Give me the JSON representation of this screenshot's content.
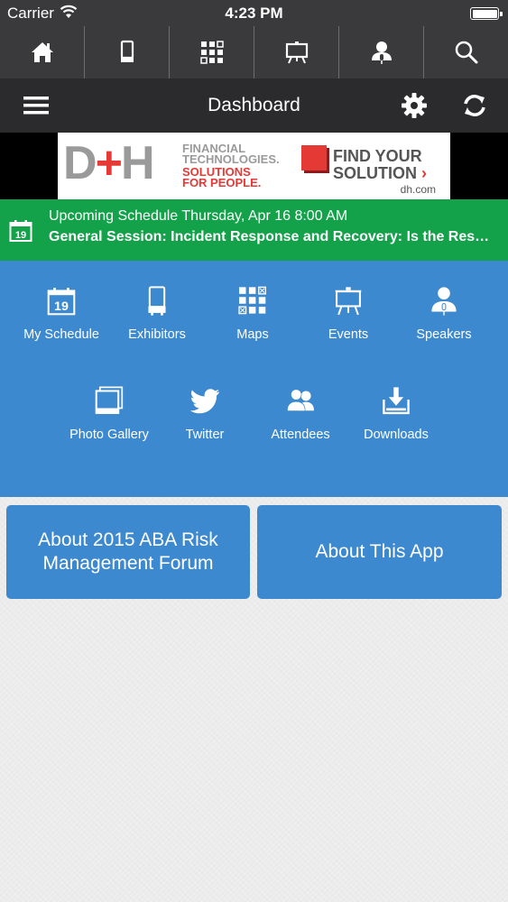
{
  "status_bar": {
    "carrier": "Carrier",
    "time": "4:23 PM"
  },
  "top_nav": {
    "items": [
      {
        "icon": "home-icon"
      },
      {
        "icon": "exhibitors-icon"
      },
      {
        "icon": "maps-icon"
      },
      {
        "icon": "events-icon"
      },
      {
        "icon": "speakers-icon"
      },
      {
        "icon": "search-icon"
      }
    ]
  },
  "title_bar": {
    "title": "Dashboard",
    "menu_icon": "hamburger-menu-icon",
    "settings_icon": "gear-icon",
    "refresh_icon": "refresh-icon"
  },
  "ad": {
    "logo_d": "D",
    "logo_plus": "+",
    "logo_h": "H",
    "ft_line1": "FINANCIAL",
    "ft_line2": "TECHNOLOGIES.",
    "sol_line1": "SOLUTIONS",
    "sol_line2": "FOR PEOPLE.",
    "cta_line1": "FIND YOUR",
    "cta_line2": "SOLUTION",
    "cta_arrow": "›",
    "url": "dh.com"
  },
  "upcoming": {
    "icon": "calendar-icon",
    "day": "19",
    "label": "Upcoming Schedule Thursday, Apr 16 8:00 AM",
    "session": "General Session: Incident Response and Recovery: Is the Response Plan Ready?"
  },
  "grid": {
    "tiles": [
      {
        "label": "My Schedule",
        "icon": "calendar-icon"
      },
      {
        "label": "Exhibitors",
        "icon": "exhibitors-icon"
      },
      {
        "label": "Maps",
        "icon": "maps-icon"
      },
      {
        "label": "Events",
        "icon": "events-icon"
      },
      {
        "label": "Speakers",
        "icon": "speakers-icon"
      },
      {
        "label": "Photo Gallery",
        "icon": "photo-gallery-icon"
      },
      {
        "label": "Twitter",
        "icon": "twitter-icon"
      },
      {
        "label": "Attendees",
        "icon": "attendees-icon"
      },
      {
        "label": "Downloads",
        "icon": "downloads-icon"
      }
    ]
  },
  "about": {
    "forum_label": "About 2015 ABA Risk Management Forum",
    "app_label": "About This App"
  },
  "colors": {
    "nav_bg": "#3a3a3c",
    "title_bg": "#2b2b2d",
    "upcoming_bg": "#13a24a",
    "accent_blue": "#3c89cf",
    "ad_red": "#e53935"
  }
}
